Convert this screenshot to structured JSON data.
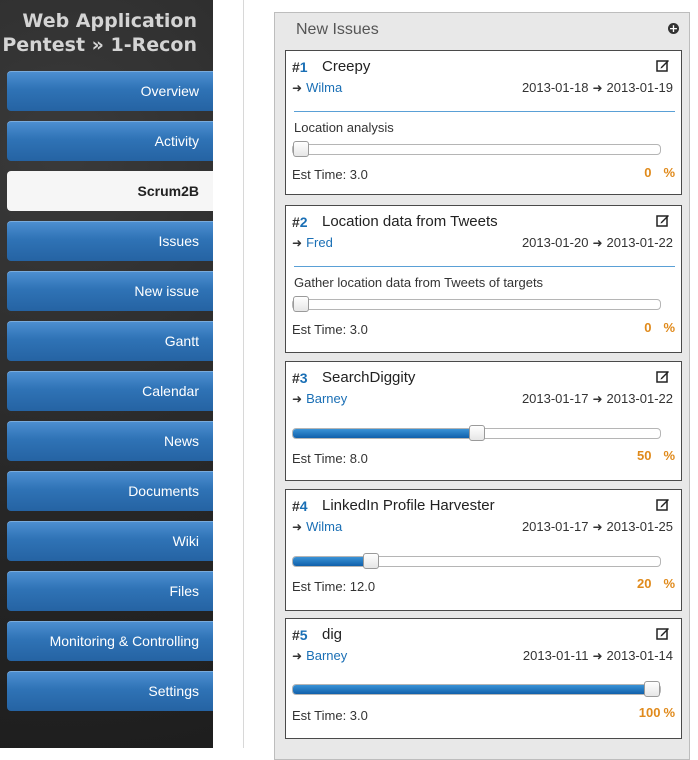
{
  "project": {
    "title_line1": "Web Application",
    "title_line2": "Pentest » 1-Recon"
  },
  "nav": [
    {
      "label": "Overview",
      "active": false
    },
    {
      "label": "Activity",
      "active": false
    },
    {
      "label": "Scrum2B",
      "active": true
    },
    {
      "label": "Issues",
      "active": false
    },
    {
      "label": "New issue",
      "active": false
    },
    {
      "label": "Gantt",
      "active": false
    },
    {
      "label": "Calendar",
      "active": false
    },
    {
      "label": "News",
      "active": false
    },
    {
      "label": "Documents",
      "active": false
    },
    {
      "label": "Wiki",
      "active": false
    },
    {
      "label": "Files",
      "active": false
    },
    {
      "label": "Monitoring & Controlling",
      "active": false
    },
    {
      "label": "Settings",
      "active": false
    }
  ],
  "panel": {
    "title": "New Issues",
    "add_icon": "plus-circle-icon"
  },
  "issues": [
    {
      "id_prefix": "#",
      "id": "1",
      "subject": "Creepy",
      "assignee": "Wilma",
      "start_date": "2013-01-18",
      "due_date": "2013-01-19",
      "description": "Location analysis",
      "est_time": "Est Time: 3.0",
      "done_ratio": 0,
      "done_text": "0",
      "percent_sign": "%"
    },
    {
      "id_prefix": "#",
      "id": "2",
      "subject": "Location data from Tweets",
      "assignee": "Fred",
      "start_date": "2013-01-20",
      "due_date": "2013-01-22",
      "description": "Gather location data from Tweets of targets",
      "est_time": "Est Time: 3.0",
      "done_ratio": 0,
      "done_text": "0",
      "percent_sign": "%"
    },
    {
      "id_prefix": "#",
      "id": "3",
      "subject": "SearchDiggity",
      "assignee": "Barney",
      "start_date": "2013-01-17",
      "due_date": "2013-01-22",
      "description": "",
      "est_time": "Est Time: 8.0",
      "done_ratio": 50,
      "done_text": "50",
      "percent_sign": "%"
    },
    {
      "id_prefix": "#",
      "id": "4",
      "subject": "LinkedIn Profile Harvester",
      "assignee": "Wilma",
      "start_date": "2013-01-17",
      "due_date": "2013-01-25",
      "description": "",
      "est_time": "Est Time: 12.0",
      "done_ratio": 20,
      "done_text": "20",
      "percent_sign": "%"
    },
    {
      "id_prefix": "#",
      "id": "5",
      "subject": "dig",
      "assignee": "Barney",
      "start_date": "2013-01-11",
      "due_date": "2013-01-14",
      "description": "",
      "est_time": "Est Time: 3.0",
      "done_ratio": 100,
      "done_text": "100",
      "percent_sign": "%"
    }
  ],
  "colors": {
    "nav_blue": "#2f73b6",
    "link_blue": "#1a6fb5",
    "percent_orange": "#e08a1b"
  }
}
